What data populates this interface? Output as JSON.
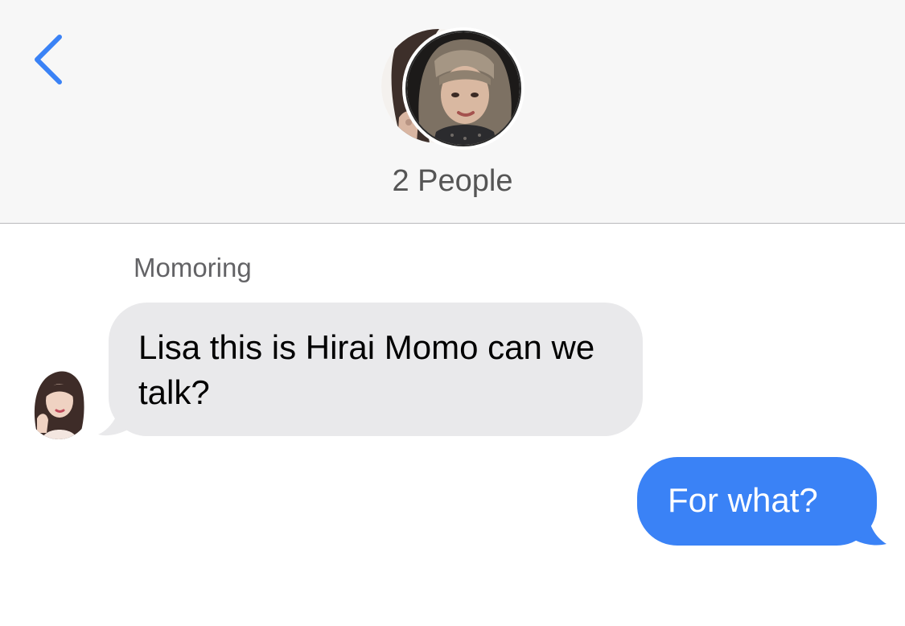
{
  "header": {
    "back_icon": "chevron-left-icon",
    "title": "2 People",
    "accent_color": "#3a82f6"
  },
  "conversation": {
    "messages": [
      {
        "direction": "incoming",
        "sender": "Momoring",
        "text": "Lisa this is Hirai Momo can we talk?"
      },
      {
        "direction": "outgoing",
        "text": "For what?"
      }
    ]
  },
  "colors": {
    "incoming_bubble": "#e9e9eb",
    "outgoing_bubble": "#3a82f6",
    "header_background": "#f7f7f7"
  }
}
